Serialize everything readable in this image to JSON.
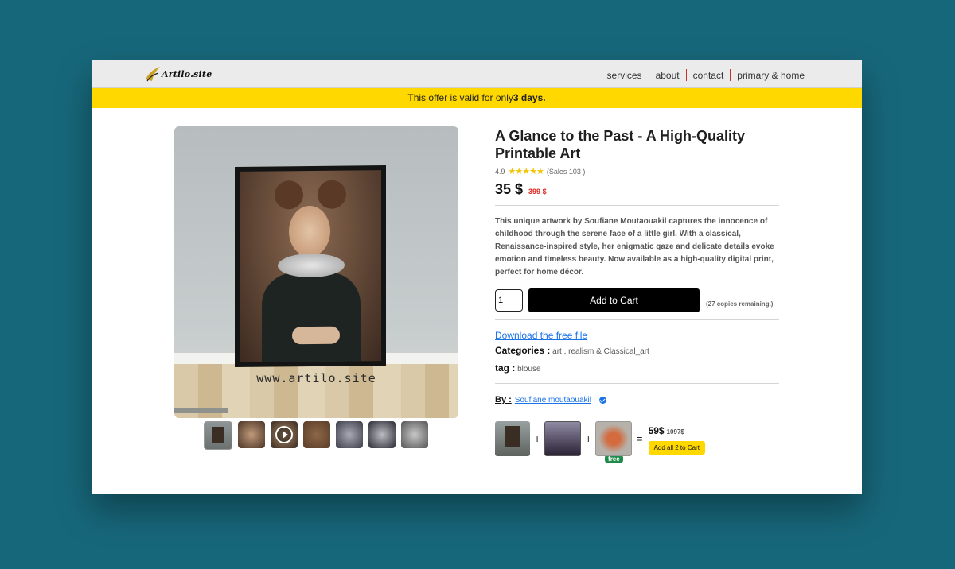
{
  "header": {
    "logo_text": "Artilo.site",
    "nav": [
      "services",
      "about",
      "contact",
      "primary & home"
    ]
  },
  "offer": {
    "text": "This offer is valid for only",
    "highlight": "3 days."
  },
  "gallery": {
    "watermark": "www.artilo.site",
    "thumbnail_count": 7
  },
  "product": {
    "title": "A Glance to the Past - A High-Quality Printable Art",
    "rating": "4.9",
    "stars": "★★★★★",
    "sales": "(Sales 103 )",
    "price": "35 $",
    "old_price": "399 $",
    "description": "This unique artwork by Soufiane Moutaouakil captures the innocence of childhood through the serene face of a little girl. With a classical, Renaissance-inspired style, her enigmatic gaze and delicate details evoke emotion and timeless beauty. Now available as a high-quality digital print, perfect for home décor.",
    "quantity": "1",
    "add_to_cart": "Add to Cart",
    "remaining": "(27 copies remaining.)",
    "download": "Download the free file",
    "categories_label": "Categories :",
    "categories": "art , realism & Classical_art",
    "tag_label": "tag :",
    "tag": "blouse",
    "by_label": "By :",
    "author": "Soufiane moutaouakil"
  },
  "bundle": {
    "plus": "+",
    "equals": "=",
    "free_badge": "free",
    "price": "59$",
    "old_price": "1097$",
    "button": "Add all 2 to Cart"
  },
  "colors": {
    "background": "#17677a",
    "offer_bar": "#ffd800",
    "accent_link": "#1a73e8",
    "old_price_red": "#e0261f",
    "free_green": "#1e8b4a"
  }
}
